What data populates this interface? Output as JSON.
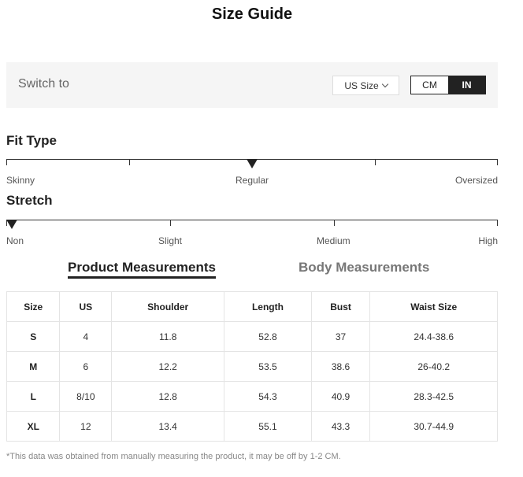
{
  "page_title": "Size Guide",
  "switch": {
    "label": "Switch to",
    "size_select": "US Size",
    "units": [
      {
        "label": "CM",
        "active": false
      },
      {
        "label": "IN",
        "active": true
      }
    ]
  },
  "fit_type": {
    "heading": "Fit Type",
    "labels": [
      "Skinny",
      "Regular",
      "Oversized"
    ],
    "selected": "Regular"
  },
  "stretch": {
    "heading": "Stretch",
    "labels": [
      "Non",
      "Slight",
      "Medium",
      "High"
    ],
    "selected": "Non"
  },
  "tabs": [
    {
      "label": "Product Measurements",
      "active": true
    },
    {
      "label": "Body Measurements",
      "active": false
    }
  ],
  "table": {
    "headers": [
      "Size",
      "US",
      "Shoulder",
      "Length",
      "Bust",
      "Waist Size"
    ],
    "rows": [
      [
        "S",
        "4",
        "11.8",
        "52.8",
        "37",
        "24.4-38.6"
      ],
      [
        "M",
        "6",
        "12.2",
        "53.5",
        "38.6",
        "26-40.2"
      ],
      [
        "L",
        "8/10",
        "12.8",
        "54.3",
        "40.9",
        "28.3-42.5"
      ],
      [
        "XL",
        "12",
        "13.4",
        "55.1",
        "43.3",
        "30.7-44.9"
      ]
    ]
  },
  "note": "*This data was obtained from manually measuring the product, it may be off by 1-2 CM."
}
